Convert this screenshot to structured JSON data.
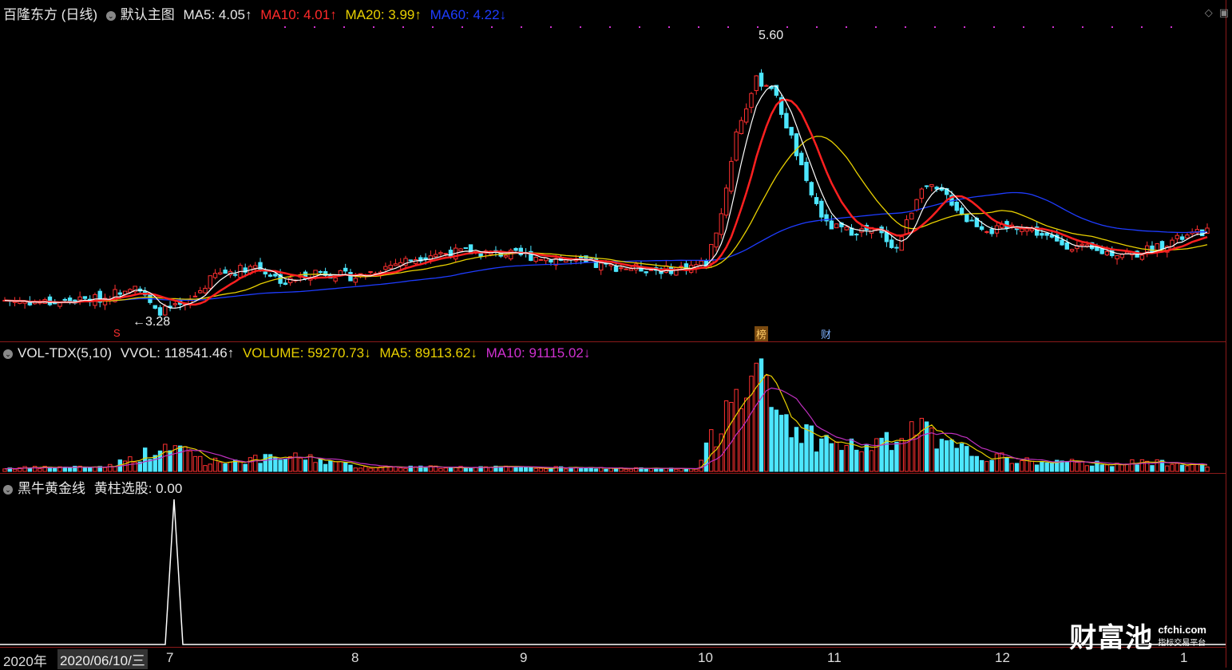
{
  "price": {
    "stock": "百隆东方 (日线)",
    "template": "默认主图",
    "ma5": "MA5: 4.05↑",
    "ma10": "MA10: 4.01↑",
    "ma20": "MA20: 3.99↑",
    "ma60": "MA60: 4.22↓",
    "high_label": "5.60",
    "low_label": "←3.28",
    "tags": {
      "s": "S",
      "bang": "榜",
      "cai": "财"
    }
  },
  "volume": {
    "name": "VOL-TDX(5,10)",
    "vvol": "VVOL: 118541.46↑",
    "volume": "VOLUME: 59270.73↓",
    "ma5": "MA5: 89113.62↓",
    "ma10": "MA10: 91115.02↓"
  },
  "indicator": {
    "name": "黑牛黄金线",
    "value": "黄柱选股: 0.00"
  },
  "time_axis": {
    "year": "2020年",
    "cursor": "2020/06/10/三",
    "months": [
      "7",
      "8",
      "9",
      "10",
      "11",
      "12",
      "1"
    ]
  },
  "icons": [
    "diamond-icon",
    "window-icon"
  ],
  "logo": {
    "main": "财富池",
    "url": "cfchi.com",
    "sub": "指标交易平台"
  },
  "colors": {
    "up": "#ff3030",
    "down": "#4de6ff",
    "ma5": "#ffffff",
    "ma10": "#ff2020",
    "ma20": "#e8d000",
    "ma60": "#1e3cff",
    "vma10": "#c030c0"
  },
  "chart_data": {
    "type": "candlestick",
    "title": "百隆东方 (日线)",
    "ylim": [
      3.1,
      5.8
    ],
    "extremes": {
      "high": 5.6,
      "low": 3.28
    },
    "close_anchors": [
      [
        0,
        3.4
      ],
      [
        10,
        3.38
      ],
      [
        20,
        3.42
      ],
      [
        26,
        3.55
      ],
      [
        30,
        3.3
      ],
      [
        36,
        3.35
      ],
      [
        42,
        3.62
      ],
      [
        50,
        3.7
      ],
      [
        56,
        3.55
      ],
      [
        62,
        3.65
      ],
      [
        70,
        3.6
      ],
      [
        78,
        3.72
      ],
      [
        85,
        3.8
      ],
      [
        92,
        3.82
      ],
      [
        100,
        3.8
      ],
      [
        110,
        3.76
      ],
      [
        118,
        3.7
      ],
      [
        125,
        3.68
      ],
      [
        132,
        3.66
      ],
      [
        140,
        3.72
      ],
      [
        143,
        4.15
      ],
      [
        146,
        4.85
      ],
      [
        150,
        5.3
      ],
      [
        153,
        5.25
      ],
      [
        157,
        4.8
      ],
      [
        160,
        4.4
      ],
      [
        164,
        4.05
      ],
      [
        168,
        4.0
      ],
      [
        174,
        4.0
      ],
      [
        178,
        3.85
      ],
      [
        183,
        4.4
      ],
      [
        188,
        4.3
      ],
      [
        192,
        4.1
      ],
      [
        197,
        4.0
      ],
      [
        203,
        4.05
      ],
      [
        210,
        3.9
      ],
      [
        218,
        3.82
      ],
      [
        226,
        3.8
      ],
      [
        232,
        3.9
      ],
      [
        240,
        4.0
      ]
    ],
    "volume_anchors": [
      [
        0,
        4000
      ],
      [
        20,
        6000
      ],
      [
        25,
        15000
      ],
      [
        28,
        22000
      ],
      [
        36,
        30000
      ],
      [
        40,
        12000
      ],
      [
        60,
        18000
      ],
      [
        70,
        6000
      ],
      [
        100,
        5000
      ],
      [
        138,
        3000
      ],
      [
        142,
        50000
      ],
      [
        146,
        130000
      ],
      [
        150,
        120000
      ],
      [
        153,
        80000
      ],
      [
        157,
        60000
      ],
      [
        162,
        40000
      ],
      [
        170,
        30000
      ],
      [
        180,
        40000
      ],
      [
        182,
        60000
      ],
      [
        186,
        35000
      ],
      [
        195,
        20000
      ],
      [
        205,
        12000
      ],
      [
        220,
        10000
      ],
      [
        235,
        12000
      ],
      [
        240,
        9000
      ]
    ]
  }
}
